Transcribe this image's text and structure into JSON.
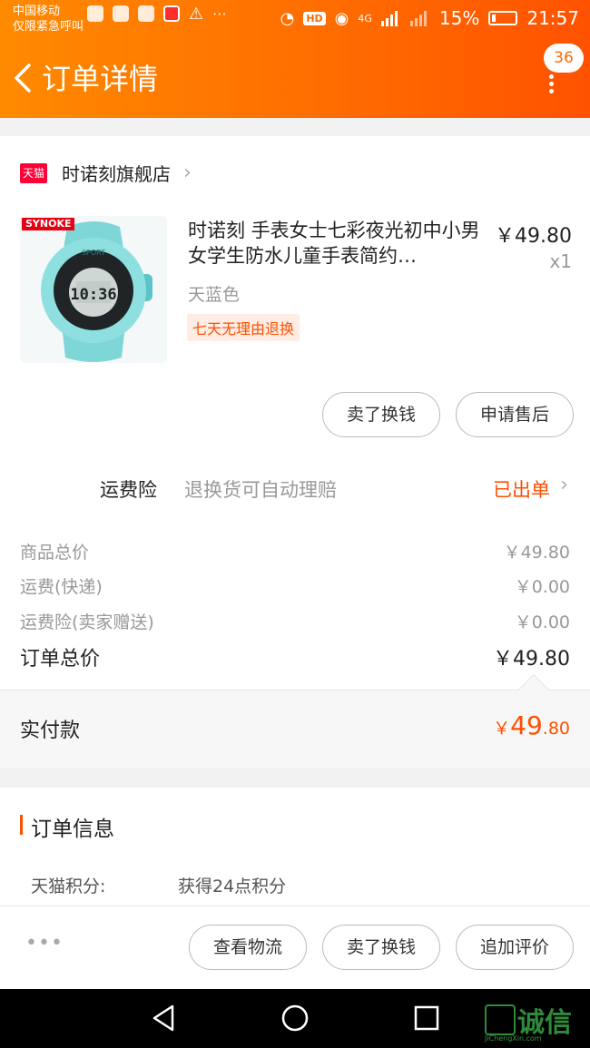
{
  "status_bar": {
    "carrier_line1": "中国移动",
    "carrier_line2": "仅限紧急呼叫",
    "network": "4G",
    "battery": "15%",
    "time": "21:57",
    "hd": "HD"
  },
  "nav": {
    "title": "订单详情",
    "notification_count": "36"
  },
  "store": {
    "badge": "天猫",
    "name": "时诺刻旗舰店"
  },
  "product": {
    "brand_tag": "SYNOKE",
    "title": "时诺刻 手表女士七彩夜光初中小男女学生防水儿童手表简约…",
    "price": "￥49.80",
    "quantity": "x1",
    "variant": "天蓝色",
    "return_policy": "七天无理由退换",
    "watch_face": {
      "brand": "SPORT",
      "time": "10:36"
    }
  },
  "item_actions": {
    "sell_for_cash": "卖了换钱",
    "after_sales": "申请售后"
  },
  "shipping_insurance": {
    "label": "运费险",
    "description": "退换货可自动理赔",
    "status": "已出单"
  },
  "price_breakdown": [
    {
      "label": "商品总价",
      "value": "￥49.80"
    },
    {
      "label": "运费(快递)",
      "value": "￥0.00"
    },
    {
      "label": "运费险(卖家赠送)",
      "value": "￥0.00"
    }
  ],
  "order_total": {
    "label": "订单总价",
    "value": "￥49.80"
  },
  "actual_paid": {
    "label": "实付款",
    "currency": "￥",
    "integer": "49",
    "decimal": ".80"
  },
  "order_info": {
    "title": "订单信息",
    "points_label": "天猫积分:",
    "points_value": "获得24点积分"
  },
  "bottom_actions": {
    "more": "•••",
    "view_logistics": "查看物流",
    "sell_for_cash": "卖了换钱",
    "add_review": "追加评价"
  },
  "watermark": {
    "text": "诚信",
    "sub": "JiChengXin.com"
  },
  "colors": {
    "header_gradient_start": "#ff8a00",
    "header_gradient_end": "#ff5200",
    "accent": "#ff5000",
    "tmall_red": "#ff0036"
  }
}
